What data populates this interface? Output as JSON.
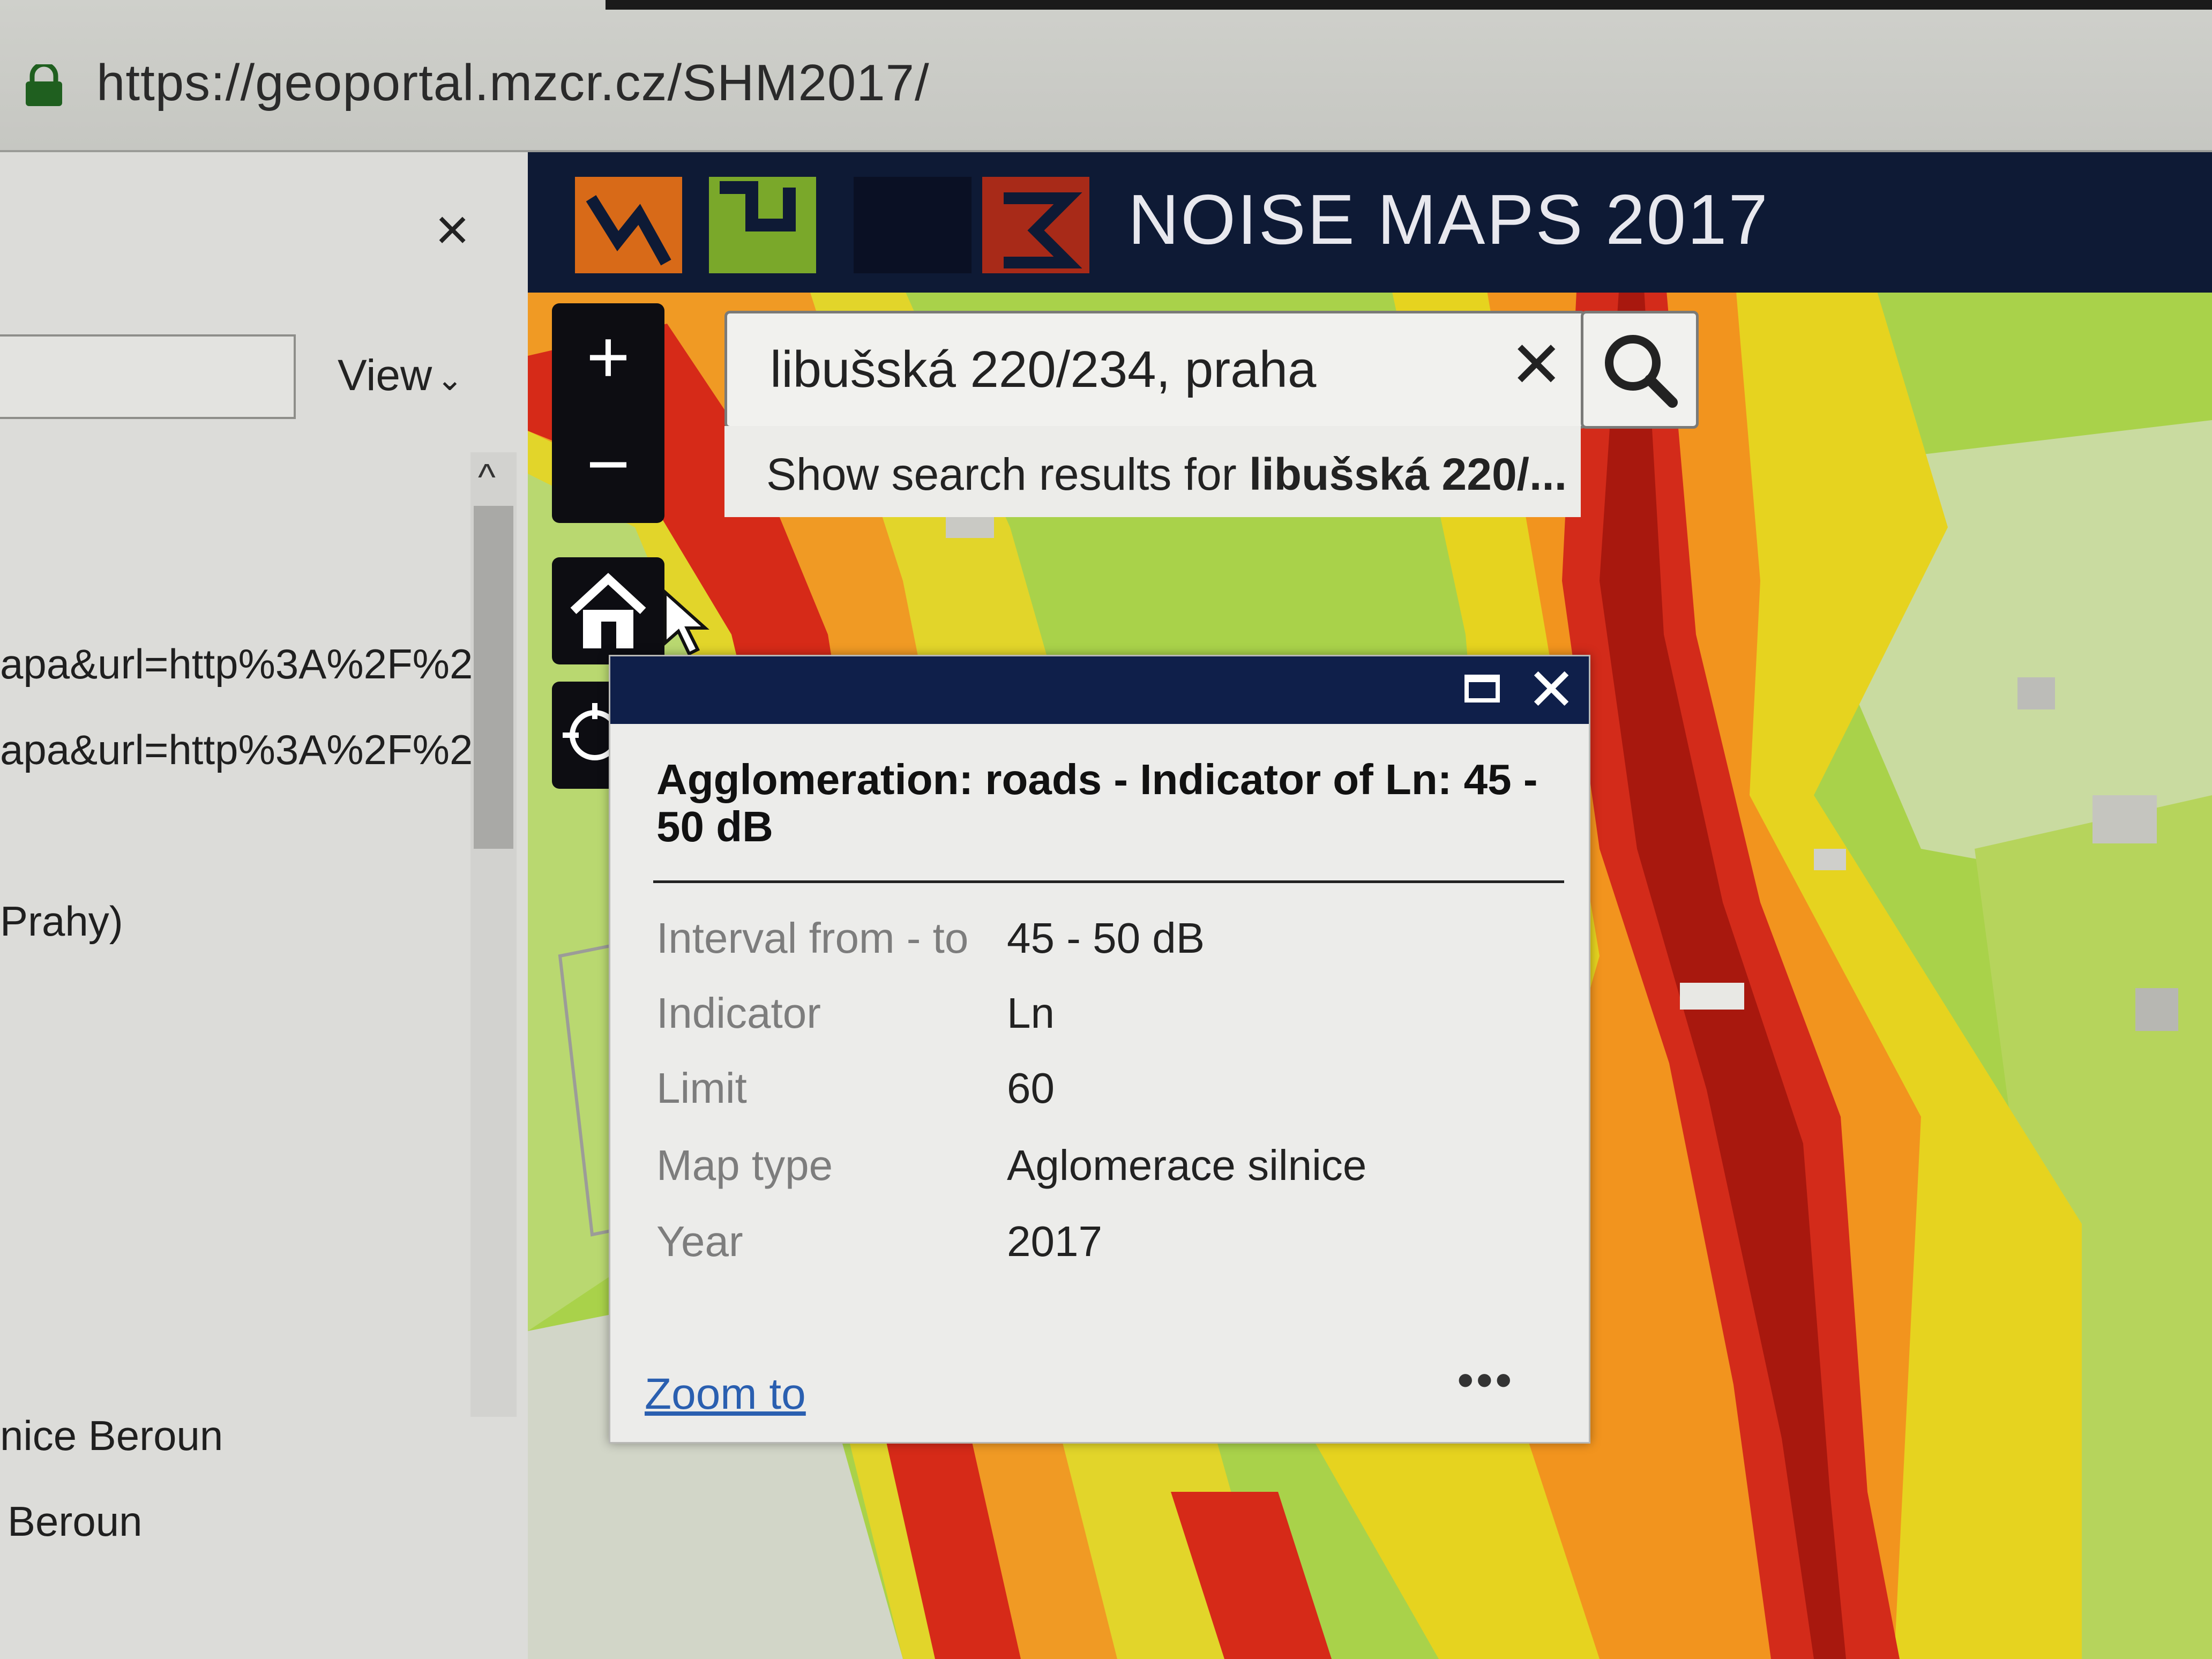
{
  "browser": {
    "url": "https://geoportal.mzcr.cz/SHM2017/"
  },
  "left_panel": {
    "close_label": "×",
    "view_label": "View",
    "lines": [
      "apa&url=http%3A%2F%2",
      "apa&url=http%3A%2F%2",
      "Prahy)",
      "nice Beroun",
      "Beroun"
    ]
  },
  "header": {
    "title": "NOISE MAPS 2017"
  },
  "map_controls": {
    "zoom_in": "+",
    "zoom_out": "−"
  },
  "search": {
    "value": "libušská 220/234, praha",
    "clear_label": "✕",
    "suggestion_prefix": "Show search results for ",
    "suggestion_bold": "libušská 220/..."
  },
  "popup": {
    "title": "Agglomeration: roads - Indicator of Ln: 45 - 50 dB",
    "attributes": [
      {
        "label": "Interval from - to",
        "value": "45 - 50 dB"
      },
      {
        "label": "Indicator",
        "value": "Ln"
      },
      {
        "label": "Limit",
        "value": "60"
      },
      {
        "label": "Map type",
        "value": "Aglomerace silnice"
      },
      {
        "label": "Year",
        "value": "2017"
      }
    ],
    "zoom_to": "Zoom to",
    "more": "•••",
    "close_label": "✕"
  },
  "colors": {
    "header_bg": "#0e1a35",
    "popup_header": "#0f1f4a",
    "noise_red": "#d42a1a",
    "noise_darkred": "#a81a10",
    "noise_orange": "#f08a1c",
    "noise_yellow": "#e8d21e",
    "noise_green": "#9fcf3a"
  },
  "icons": [
    "lock-icon",
    "close-icon",
    "chevron-down-icon",
    "chevron-up-icon",
    "search-icon",
    "home-icon",
    "locate-icon",
    "maximize-icon",
    "cursor-icon"
  ]
}
